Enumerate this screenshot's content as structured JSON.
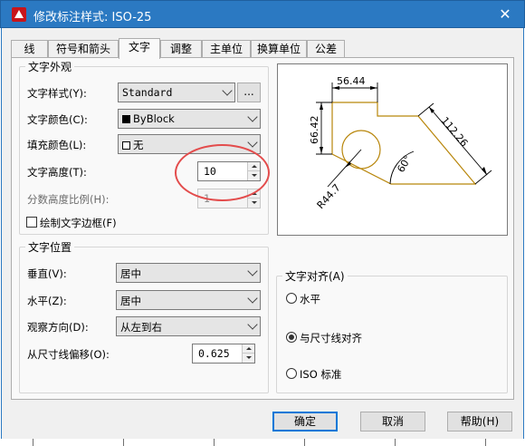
{
  "window": {
    "title": "修改标注样式: ISO-25",
    "close_glyph": "✕",
    "app_icon": "autocad-icon"
  },
  "tabs": [
    "线",
    "符号和箭头",
    "文字",
    "调整",
    "主单位",
    "换算单位",
    "公差"
  ],
  "active_tab": "文字",
  "text_appearance": {
    "group_title": "文字外观",
    "text_style_label": "文字样式(Y):",
    "text_style_value": "Standard",
    "text_style_button": "...",
    "text_color_label": "文字颜色(C):",
    "text_color_value": "ByBlock",
    "fill_color_label": "填充颜色(L):",
    "fill_color_value": "无",
    "text_height_label": "文字高度(T):",
    "text_height_value": "10",
    "fraction_scale_label": "分数高度比例(H):",
    "fraction_scale_value": "1",
    "draw_frame_label": "绘制文字边框(F)"
  },
  "text_placement": {
    "group_title": "文字位置",
    "vertical_label": "垂直(V):",
    "vertical_value": "居中",
    "horizontal_label": "水平(Z):",
    "horizontal_value": "居中",
    "view_direction_label": "观察方向(D):",
    "view_direction_value": "从左到右",
    "offset_label": "从尺寸线偏移(O):",
    "offset_value": "0.625"
  },
  "text_alignment": {
    "group_title": "文字对齐(A)",
    "options": [
      "水平",
      "与尺寸线对齐",
      "ISO 标准"
    ],
    "selected": "与尺寸线对齐"
  },
  "preview": {
    "dim_top": "56.44",
    "dim_left": "66.42",
    "dim_right": "112.26",
    "dim_angle": "60°",
    "dim_radius": "R44.7"
  },
  "buttons": {
    "ok": "确定",
    "cancel": "取消",
    "help": "帮助(H)"
  },
  "colors": {
    "titlebar": "#2b79c2",
    "preview_geometry": "#b8860b",
    "highlight_ellipse": "#e34c4c"
  }
}
